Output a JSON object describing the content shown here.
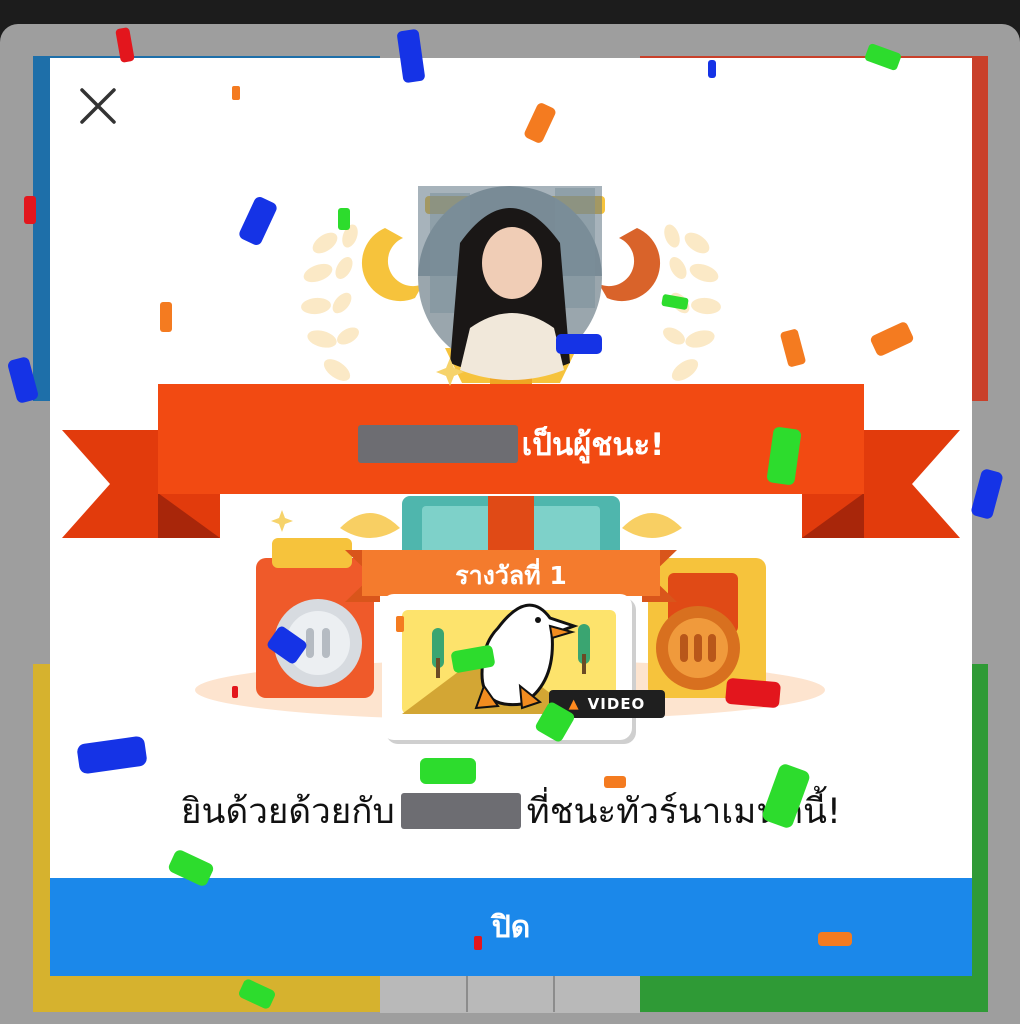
{
  "modal": {
    "winner_text": "เป็นผู้ชนะ!",
    "prize_rank": "รางวัลที่ 1",
    "prize_badge": "VIDEO",
    "message_prefix": "ยินด้วยด้วยกับ",
    "message_suffix": "ที่ชนะทัวร์นาเมนต์นี้!",
    "close_button": "ปิด"
  },
  "colors": {
    "primary_button": "#1b88ea",
    "ribbon": "#f24a12",
    "ribbon_dark": "#c93408",
    "prize_ribbon": "#f47b2d",
    "trophy_gold": "#f6c33c"
  },
  "icons": {
    "close": "close-icon",
    "avatar": "winner-avatar",
    "trophy": "trophy-icon",
    "silver_coin": "silver-coin-icon",
    "bronze_coin": "bronze-coin-icon",
    "mascot": "duck-mascot-icon",
    "fire": "fire-icon"
  }
}
